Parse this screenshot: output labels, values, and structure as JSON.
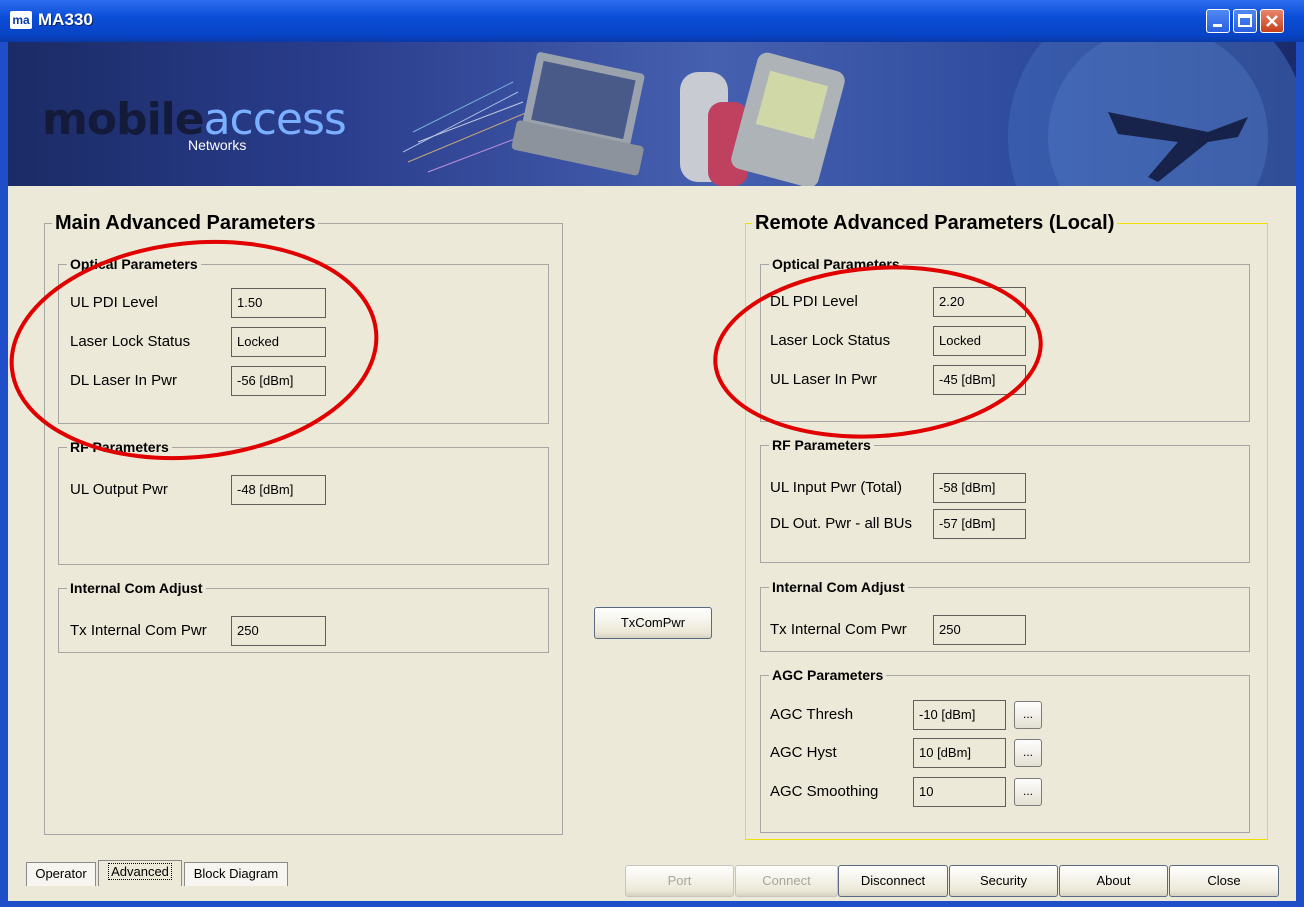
{
  "window": {
    "title": "MA330",
    "app_icon_text": "ma",
    "controls": [
      "minimize",
      "maximize",
      "close"
    ]
  },
  "banner": {
    "logo_main": "mobile",
    "logo_accent": "access",
    "logo_sub": "Networks"
  },
  "main": {
    "title": "Main Advanced Parameters",
    "optical": {
      "title": "Optical Parameters",
      "rows": [
        {
          "label": "UL PDI Level",
          "value": "1.50"
        },
        {
          "label": "Laser Lock Status",
          "value": "Locked"
        },
        {
          "label": "DL Laser In Pwr",
          "value": "-56 [dBm]"
        }
      ]
    },
    "rf": {
      "title": "RF Parameters",
      "rows": [
        {
          "label": "UL Output Pwr",
          "value": "-48 [dBm]"
        }
      ]
    },
    "com": {
      "title": "Internal Com Adjust",
      "rows": [
        {
          "label": "Tx Internal Com Pwr",
          "value": "250"
        }
      ]
    }
  },
  "center": {
    "txcompwr_label": "TxComPwr"
  },
  "remote": {
    "title": "Remote Advanced Parameters (Local)",
    "optical": {
      "title": "Optical Parameters",
      "rows": [
        {
          "label": "DL PDI Level",
          "value": "2.20"
        },
        {
          "label": "Laser Lock Status",
          "value": "Locked"
        },
        {
          "label": "UL Laser In Pwr",
          "value": "-45 [dBm]"
        }
      ]
    },
    "rf": {
      "title": "RF Parameters",
      "rows": [
        {
          "label": "UL Input Pwr (Total)",
          "value": "-58 [dBm]"
        },
        {
          "label": "DL Out. Pwr - all BUs",
          "value": "-57 [dBm]"
        }
      ]
    },
    "com": {
      "title": "Internal Com Adjust",
      "rows": [
        {
          "label": "Tx Internal Com Pwr",
          "value": "250"
        }
      ]
    },
    "agc": {
      "title": "AGC Parameters",
      "rows": [
        {
          "label": "AGC Thresh",
          "value": "-10 [dBm]",
          "button": "..."
        },
        {
          "label": "AGC Hyst",
          "value": "10 [dBm]",
          "button": "..."
        },
        {
          "label": "AGC Smoothing",
          "value": "10",
          "button": "..."
        }
      ]
    }
  },
  "tabs": [
    {
      "label": "Operator"
    },
    {
      "label": "Advanced"
    },
    {
      "label": "Block Diagram"
    }
  ],
  "footer_buttons": [
    {
      "label": "Port",
      "enabled": false
    },
    {
      "label": "Connect",
      "enabled": false
    },
    {
      "label": "Disconnect",
      "enabled": true
    },
    {
      "label": "Security",
      "enabled": true
    },
    {
      "label": "About",
      "enabled": true
    },
    {
      "label": "Close",
      "enabled": true
    }
  ],
  "colors": {
    "title_bar": "#0b4ed8",
    "client_bg": "#ece9d8",
    "remote_group_border": "#f0e000",
    "annotation_ellipse": "#e00000"
  }
}
